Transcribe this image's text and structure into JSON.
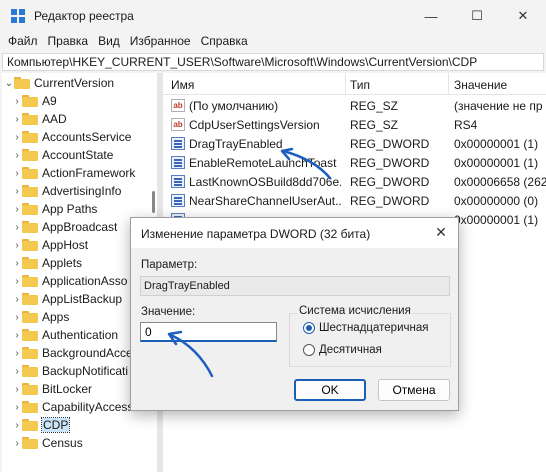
{
  "window": {
    "title": "Редактор реестра",
    "minimize_glyph": "—",
    "maximize_glyph": "☐",
    "close_glyph": "✕"
  },
  "menu": [
    "Файл",
    "Правка",
    "Вид",
    "Избранное",
    "Справка"
  ],
  "address": "Компьютер\\HKEY_CURRENT_USER\\Software\\Microsoft\\Windows\\CurrentVersion\\CDP",
  "tree": {
    "root": "CurrentVersion",
    "items": [
      {
        "label": "A9",
        "expandable": true
      },
      {
        "label": "AAD",
        "expandable": true
      },
      {
        "label": "AccountsService",
        "expandable": true
      },
      {
        "label": "AccountState",
        "expandable": true
      },
      {
        "label": "ActionFramework",
        "expandable": true
      },
      {
        "label": "AdvertisingInfo",
        "expandable": true
      },
      {
        "label": "App Paths",
        "expandable": true
      },
      {
        "label": "AppBroadcast",
        "expandable": true
      },
      {
        "label": "AppHost",
        "expandable": true
      },
      {
        "label": "Applets",
        "expandable": true
      },
      {
        "label": "ApplicationAsso",
        "expandable": true
      },
      {
        "label": "AppListBackup",
        "expandable": true
      },
      {
        "label": "Apps",
        "expandable": true
      },
      {
        "label": "Authentication",
        "expandable": true
      },
      {
        "label": "BackgroundAcce",
        "expandable": true
      },
      {
        "label": "BackupNotificati",
        "expandable": true
      },
      {
        "label": "BitLocker",
        "expandable": true
      },
      {
        "label": "CapabilityAccess",
        "expandable": true
      },
      {
        "label": "CDP",
        "expandable": true,
        "selected": true
      },
      {
        "label": "Census",
        "expandable": true
      }
    ]
  },
  "list": {
    "columns": {
      "name": "Имя",
      "type": "Тип",
      "value": "Значение"
    },
    "rows": [
      {
        "icon": "string-value-icon",
        "name": "(По умолчанию)",
        "type": "REG_SZ",
        "value": "(значение не пр"
      },
      {
        "icon": "string-value-icon",
        "name": "CdpUserSettingsVersion",
        "type": "REG_SZ",
        "value": "RS4"
      },
      {
        "icon": "dword-value-icon",
        "name": "DragTrayEnabled",
        "type": "REG_DWORD",
        "value": "0x00000001 (1)"
      },
      {
        "icon": "dword-value-icon",
        "name": "EnableRemoteLaunchToast",
        "type": "REG_DWORD",
        "value": "0x00000001 (1)"
      },
      {
        "icon": "dword-value-icon",
        "name": "LastKnownOSBuild8dd706e...",
        "type": "REG_DWORD",
        "value": "0x00006658 (2620"
      },
      {
        "icon": "dword-value-icon",
        "name": "NearShareChannelUserAut...",
        "type": "REG_DWORD",
        "value": "0x00000000 (0)"
      },
      {
        "icon": "dword-value-icon",
        "name": "",
        "type": "",
        "value": "0x00000001 (1)"
      }
    ],
    "ab_glyph": "ab"
  },
  "dialog": {
    "title": "Изменение параметра DWORD (32 бита)",
    "close_glyph": "✕",
    "param_label": "Параметр:",
    "param_value": "DragTrayEnabled",
    "value_label": "Значение:",
    "value_input": "0",
    "radix_group": "Система исчисления",
    "radix_hex": "Шестнадцатеричная",
    "radix_dec": "Десятичная",
    "ok": "OK",
    "cancel": "Отмена"
  },
  "colors": {
    "accent": "#1b5fb5",
    "annotation": "#1f5ebf",
    "folder": "#f4c94f",
    "selection": "#cce4f7"
  }
}
